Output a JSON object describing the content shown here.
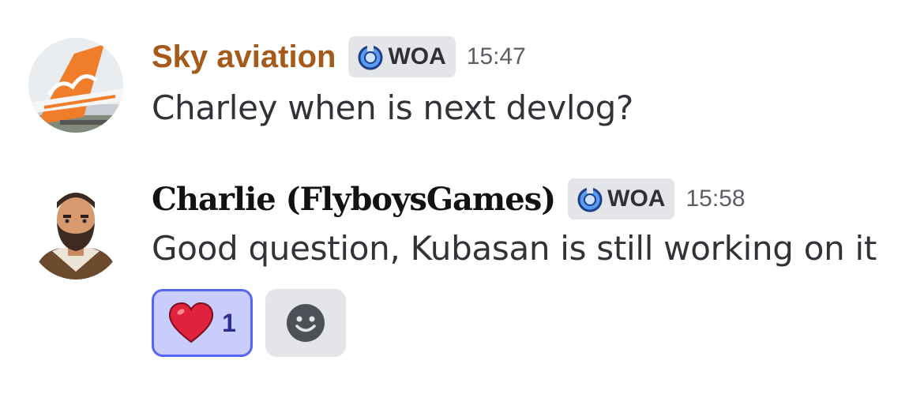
{
  "messages": [
    {
      "username": "Sky aviation",
      "username_color": "#a35a1a",
      "tag": "WOA",
      "timestamp": "15:47",
      "content": "Charley when is next devlog?",
      "avatar_icon": "skyup-plane-tail-avatar"
    },
    {
      "username": "Charlie (FlyboysGames)",
      "username_color": "#111214",
      "tag": "WOA",
      "timestamp": "15:58",
      "content": "Good question, Kubasan is still working on it",
      "avatar_icon": "bearded-pilot-avatar",
      "reactions": [
        {
          "emoji": "❤️",
          "icon": "red-heart-icon",
          "count": "1",
          "selected": true
        }
      ],
      "add_reaction_icon": "smiley-add-reaction-icon"
    }
  ],
  "colors": {
    "accent": "#5865f2",
    "reaction_bg": "#c9cdfb",
    "tag_bg": "#e4e5e8",
    "text": "#313338",
    "timestamp": "#5c5e66"
  }
}
